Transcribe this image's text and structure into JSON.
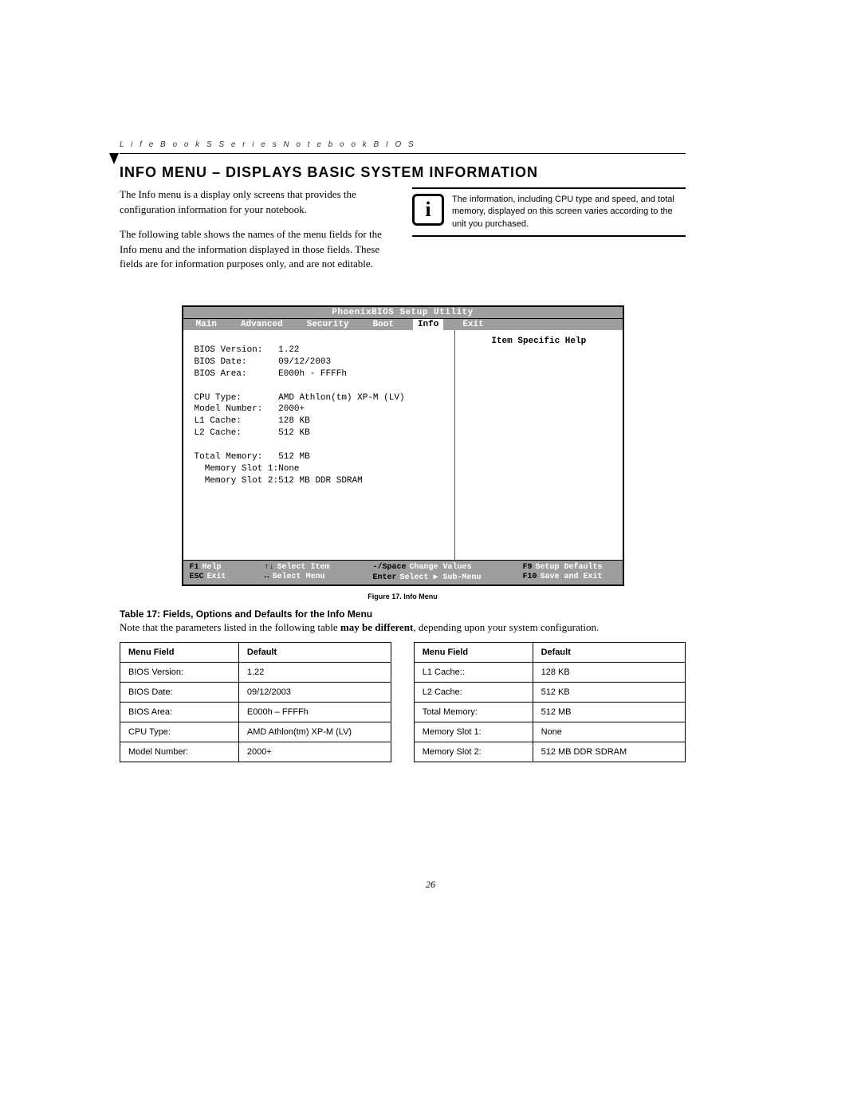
{
  "header": {
    "breadcrumb": "L i f e B o o k   S   S e r i e s   N o t e b o o k   B I O S"
  },
  "title": "INFO MENU – DISPLAYS BASIC SYSTEM INFORMATION",
  "intro": {
    "p1": "The Info menu is a display only screens that provides the configuration information for your notebook.",
    "p2": "The following table shows the names of the menu fields for the Info menu and the information displayed in those fields. These fields are for information purposes only, and are not editable."
  },
  "info_panel": "The information, including CPU type and speed, and total memory, displayed on this screen varies according to the unit you purchased.",
  "bios": {
    "window_title": "PhoenixBIOS Setup Utility",
    "tabs": [
      "Main",
      "Advanced",
      "Security",
      "Boot",
      "Info",
      "Exit"
    ],
    "active_tab_index": 4,
    "help_title": "Item Specific Help",
    "fields": [
      {
        "label": "BIOS Version:",
        "value": "1.22"
      },
      {
        "label": "BIOS Date:",
        "value": "09/12/2003"
      },
      {
        "label": "BIOS Area:",
        "value": "E000h - FFFFh"
      },
      {
        "label": "",
        "value": ""
      },
      {
        "label": "CPU Type:",
        "value": "AMD Athlon(tm) XP-M (LV)"
      },
      {
        "label": "Model Number:",
        "value": "2000+"
      },
      {
        "label": "L1 Cache:",
        "value": "128 KB"
      },
      {
        "label": "L2 Cache:",
        "value": "512 KB"
      },
      {
        "label": "",
        "value": ""
      },
      {
        "label": "Total Memory:",
        "value": "512 MB"
      },
      {
        "label": "  Memory Slot 1:",
        "value": "None"
      },
      {
        "label": "  Memory Slot 2:",
        "value": "512 MB DDR SDRAM"
      }
    ],
    "footer": {
      "r1": {
        "k1": "F1",
        "l1": "Help",
        "k2": "↑↓",
        "l2": "Select Item",
        "k3": "-/Space",
        "l3": "Change Values",
        "k4": "F9",
        "l4": "Setup Defaults"
      },
      "r2": {
        "k1": "ESC",
        "l1": "Exit",
        "k2": "↔",
        "l2": "Select Menu",
        "k3": "Enter",
        "l3": "Select ▶ Sub-Menu",
        "k4": "F10",
        "l4": "Save and Exit"
      }
    }
  },
  "figure_caption": "Figure 17.  Info Menu",
  "table_title": "Table 17: Fields, Options and Defaults for the Info Menu",
  "table_note_prefix": "Note that the parameters listed in the following table ",
  "table_note_bold": "may be different",
  "table_note_suffix": ", depending upon your system configuration.",
  "table": {
    "headers": [
      "Menu Field",
      "Default",
      "Menu Field",
      "Default"
    ],
    "rows": [
      [
        "BIOS Version:",
        "1.22",
        "L1 Cache::",
        "128 KB"
      ],
      [
        "BIOS Date:",
        "09/12/2003",
        "L2 Cache:",
        "512 KB"
      ],
      [
        "BIOS Area:",
        "E000h – FFFFh",
        "Total Memory:",
        "512 MB"
      ],
      [
        "CPU Type:",
        "AMD Athlon(tm) XP-M (LV)",
        "  Memory Slot 1:",
        "None"
      ],
      [
        "Model Number:",
        "2000+",
        "  Memory Slot 2:",
        "512 MB DDR SDRAM"
      ]
    ]
  },
  "page_number": "26"
}
